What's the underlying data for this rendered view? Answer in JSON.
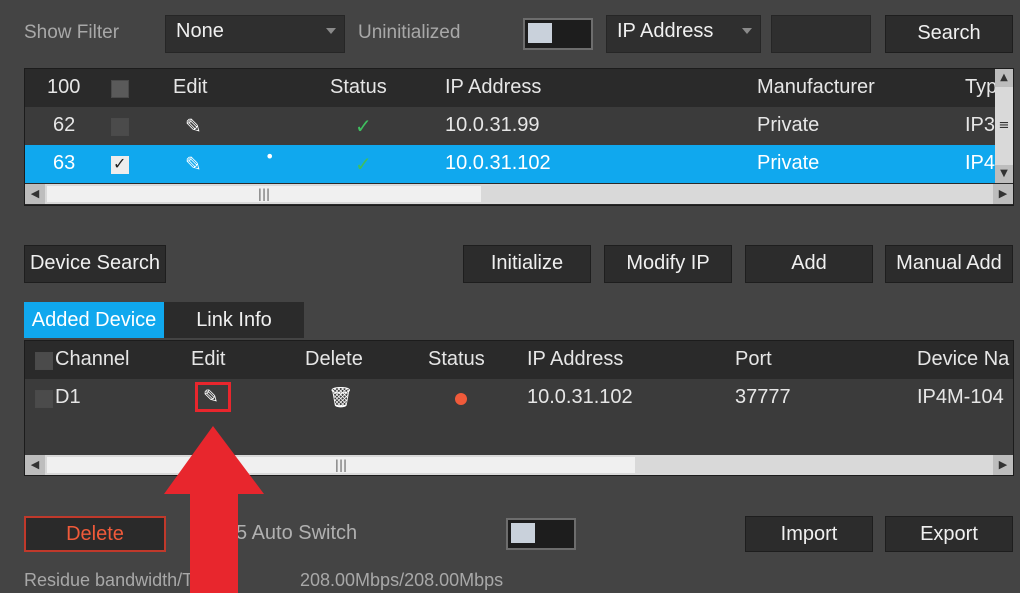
{
  "filter_bar": {
    "show_filter_label": "Show Filter",
    "show_filter_value": "None",
    "uninitialized_label": "Uninitialized",
    "search_type_value": "IP Address",
    "search_value": "",
    "search_button": "Search"
  },
  "device_table": {
    "headers": {
      "count": "100",
      "edit": "Edit",
      "status": "Status",
      "ip_address": "IP Address",
      "manufacturer": "Manufacturer",
      "type": "Typ"
    },
    "rows": [
      {
        "index": "62",
        "checked": false,
        "status": "online",
        "ip": "10.0.31.99",
        "manufacturer": "Private",
        "type": "IP3"
      },
      {
        "index": "63",
        "checked": true,
        "status": "online",
        "ip": "10.0.31.102",
        "manufacturer": "Private",
        "type": "IP4"
      }
    ]
  },
  "actions": {
    "device_search": "Device Search",
    "initialize": "Initialize",
    "modify_ip": "Modify IP",
    "add": "Add",
    "manual_add": "Manual Add"
  },
  "tabs": {
    "added_device": "Added Device",
    "link_info": "Link Info"
  },
  "added_table": {
    "headers": {
      "channel": "Channel",
      "edit": "Edit",
      "delete": "Delete",
      "status": "Status",
      "ip_address": "IP Address",
      "port": "Port",
      "device_name": "Device Na"
    },
    "rows": [
      {
        "channel": "D1",
        "status": "offline",
        "ip": "10.0.31.102",
        "port": "37777",
        "device_name": "IP4M-104"
      }
    ]
  },
  "bottom": {
    "delete_button": "Delete",
    "auto_switch_label": "5 Auto Switch",
    "import_button": "Import",
    "export_button": "Export",
    "bandwidth_label": "Residue bandwidth/T...",
    "bandwidth_value": "208.00Mbps/208.00Mbps"
  },
  "colors": {
    "selection": "#10a8ee",
    "online": "#3fbf5f",
    "offline": "#f05a3a",
    "annotation": "#e8262d",
    "delete_text": "#f05a3a"
  },
  "icons": {
    "edit": "pencil-icon",
    "delete": "trash-icon",
    "status_online": "check-icon",
    "status_offline": "dot-icon",
    "annotation": "red-arrow-icon"
  }
}
